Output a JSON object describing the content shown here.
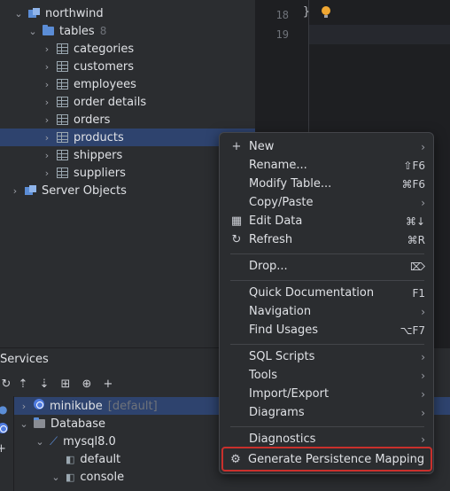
{
  "tree": {
    "db": {
      "label": "northwind"
    },
    "tables": {
      "label": "tables",
      "count": "8"
    },
    "items": [
      {
        "label": "categories"
      },
      {
        "label": "customers"
      },
      {
        "label": "employees"
      },
      {
        "label": "order details"
      },
      {
        "label": "orders"
      },
      {
        "label": "products"
      },
      {
        "label": "shippers"
      },
      {
        "label": "suppliers"
      }
    ],
    "server_objects": {
      "label": "Server Objects"
    }
  },
  "editor": {
    "lines": [
      "18",
      "19"
    ],
    "brace": "}"
  },
  "services": {
    "title": "Services",
    "rows": [
      {
        "label": "minikube",
        "tag": "[default]"
      },
      {
        "label": "Database"
      },
      {
        "label": "mysql8.0"
      },
      {
        "label": "default"
      },
      {
        "label": "console"
      }
    ]
  },
  "menu": {
    "items": [
      {
        "icon": "+",
        "label": "New",
        "key": "",
        "arrow": "›"
      },
      {
        "icon": "",
        "label": "Rename...",
        "key": "⇧F6",
        "arrow": ""
      },
      {
        "icon": "",
        "label": "Modify Table...",
        "key": "⌘F6",
        "arrow": ""
      },
      {
        "icon": "",
        "label": "Copy/Paste",
        "key": "",
        "arrow": "›"
      },
      {
        "icon": "▦",
        "label": "Edit Data",
        "key": "⌘↓",
        "arrow": ""
      },
      {
        "icon": "↻",
        "label": "Refresh",
        "key": "⌘R",
        "arrow": ""
      },
      {
        "icon": "",
        "label": "Drop...",
        "key": "⌦",
        "arrow": ""
      },
      {
        "icon": "",
        "label": "Quick Documentation",
        "key": "F1",
        "arrow": ""
      },
      {
        "icon": "",
        "label": "Navigation",
        "key": "",
        "arrow": "›"
      },
      {
        "icon": "",
        "label": "Find Usages",
        "key": "⌥F7",
        "arrow": ""
      },
      {
        "icon": "",
        "label": "SQL Scripts",
        "key": "",
        "arrow": "›"
      },
      {
        "icon": "",
        "label": "Tools",
        "key": "",
        "arrow": "›"
      },
      {
        "icon": "",
        "label": "Import/Export",
        "key": "",
        "arrow": "›"
      },
      {
        "icon": "",
        "label": "Diagrams",
        "key": "",
        "arrow": "›"
      },
      {
        "icon": "",
        "label": "Diagnostics",
        "key": "",
        "arrow": "›"
      },
      {
        "icon": "⚙",
        "label": "Generate Persistence Mapping",
        "key": "",
        "arrow": ""
      }
    ]
  }
}
